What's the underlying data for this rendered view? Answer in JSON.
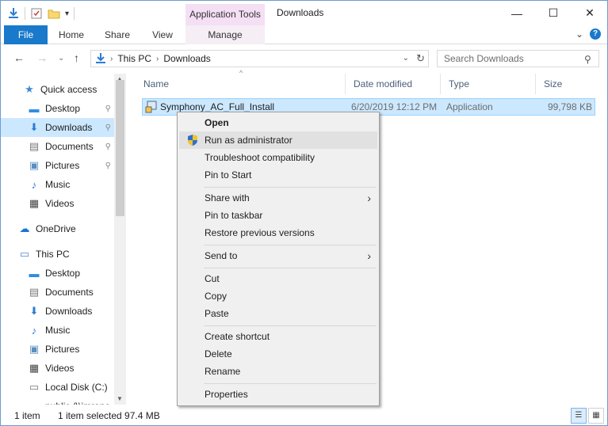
{
  "window": {
    "title": "Downloads",
    "context_tab_header": "Application Tools",
    "controls": {
      "minimize": "—",
      "maximize": "☐",
      "close": "✕"
    }
  },
  "ribbon": {
    "tabs": [
      "File",
      "Home",
      "Share",
      "View",
      "Manage"
    ],
    "expand_icon": "⌄",
    "help_icon": "?"
  },
  "address": {
    "back": "←",
    "forward": "→",
    "recent": "⌄",
    "up": "↑",
    "crumbs": [
      "This PC",
      "Downloads"
    ],
    "search_placeholder": "Search Downloads"
  },
  "nav": {
    "items": [
      {
        "label": "Quick access",
        "icon": "star-icon",
        "glyph": "★",
        "color": "#3c8ad8"
      },
      {
        "label": "Desktop",
        "icon": "desktop-icon",
        "glyph": "▬",
        "color": "#2f8de0",
        "pinned": true
      },
      {
        "label": "Downloads",
        "icon": "download-icon",
        "glyph": "⬇",
        "color": "#2b7cd3",
        "pinned": true,
        "selected": true
      },
      {
        "label": "Documents",
        "icon": "documents-icon",
        "glyph": "▤",
        "color": "#777777",
        "pinned": true
      },
      {
        "label": "Pictures",
        "icon": "pictures-icon",
        "glyph": "▣",
        "color": "#5a8fc0",
        "pinned": true
      },
      {
        "label": "Music",
        "icon": "music-icon",
        "glyph": "♪",
        "color": "#2b7cd3"
      },
      {
        "label": "Videos",
        "icon": "videos-icon",
        "glyph": "▦",
        "color": "#444444"
      },
      {
        "label": "OneDrive",
        "icon": "onedrive-icon",
        "glyph": "☁",
        "color": "#1a73d9"
      },
      {
        "label": "This PC",
        "icon": "this-pc-icon",
        "glyph": "▭",
        "color": "#4a8cd6"
      },
      {
        "label": "Desktop",
        "icon": "desktop-icon",
        "glyph": "▬",
        "color": "#2f8de0"
      },
      {
        "label": "Documents",
        "icon": "documents-icon",
        "glyph": "▤",
        "color": "#777777"
      },
      {
        "label": "Downloads",
        "icon": "download-icon",
        "glyph": "⬇",
        "color": "#2b7cd3"
      },
      {
        "label": "Music",
        "icon": "music-icon",
        "glyph": "♪",
        "color": "#2b7cd3"
      },
      {
        "label": "Pictures",
        "icon": "pictures-icon",
        "glyph": "▣",
        "color": "#5a8fc0"
      },
      {
        "label": "Videos",
        "icon": "videos-icon",
        "glyph": "▦",
        "color": "#444444"
      },
      {
        "label": "Local Disk (C:)",
        "icon": "disk-icon",
        "glyph": "▭",
        "color": "#777777"
      },
      {
        "label": "public (\\\\imrone",
        "icon": "network-drive-icon",
        "glyph": "▭",
        "color": "#777777"
      }
    ],
    "pin_glyph": "📌"
  },
  "columns": {
    "name": "Name",
    "date": "Date modified",
    "type": "Type",
    "size": "Size"
  },
  "file": {
    "name": "Symphony_AC_Full_Install",
    "date": "6/20/2019 12:12 PM",
    "type": "Application",
    "size": "99,798 KB"
  },
  "context_menu": {
    "open": "Open",
    "run_as_admin": "Run as administrator",
    "troubleshoot": "Troubleshoot compatibility",
    "pin_start": "Pin to Start",
    "share_with": "Share with",
    "pin_taskbar": "Pin to taskbar",
    "restore": "Restore previous versions",
    "send_to": "Send to",
    "cut": "Cut",
    "copy": "Copy",
    "paste": "Paste",
    "create_shortcut": "Create shortcut",
    "delete": "Delete",
    "rename": "Rename",
    "properties": "Properties",
    "submenu_arrow": "›"
  },
  "status": {
    "count": "1 item",
    "selected": "1 item selected  97.4 MB"
  },
  "colors": {
    "accent": "#1979ca",
    "selection": "#cce8ff",
    "context_tab": "#f5dff5"
  }
}
